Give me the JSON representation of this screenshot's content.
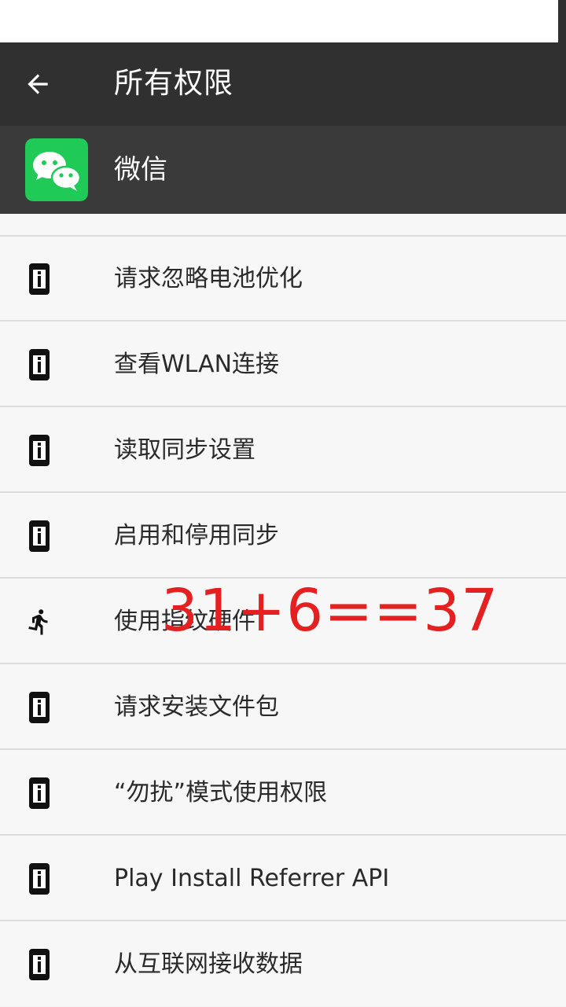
{
  "toolbar": {
    "title": "所有权限",
    "back_icon": "arrow-left-icon"
  },
  "app": {
    "name": "微信",
    "icon": "wechat-logo",
    "icon_color": "#1fca57"
  },
  "permissions": [
    {
      "label": "请求忽略电池优化",
      "icon": "info-device-icon"
    },
    {
      "label": "查看WLAN连接",
      "icon": "info-device-icon"
    },
    {
      "label": "读取同步设置",
      "icon": "info-device-icon"
    },
    {
      "label": "启用和停用同步",
      "icon": "info-device-icon"
    },
    {
      "label": "使用指纹硬件",
      "icon": "running-man-icon"
    },
    {
      "label": "请求安装文件包",
      "icon": "info-device-icon"
    },
    {
      "label": "“勿扰”模式使用权限",
      "icon": "info-device-icon"
    },
    {
      "label": "Play Install Referrer API",
      "icon": "info-device-icon"
    },
    {
      "label": "从互联网接收数据",
      "icon": "info-device-icon"
    }
  ],
  "overlay_text": "31+6==37",
  "colors": {
    "appbar": "#303030",
    "header": "#3a3a3a",
    "overlay": "#e52020"
  }
}
